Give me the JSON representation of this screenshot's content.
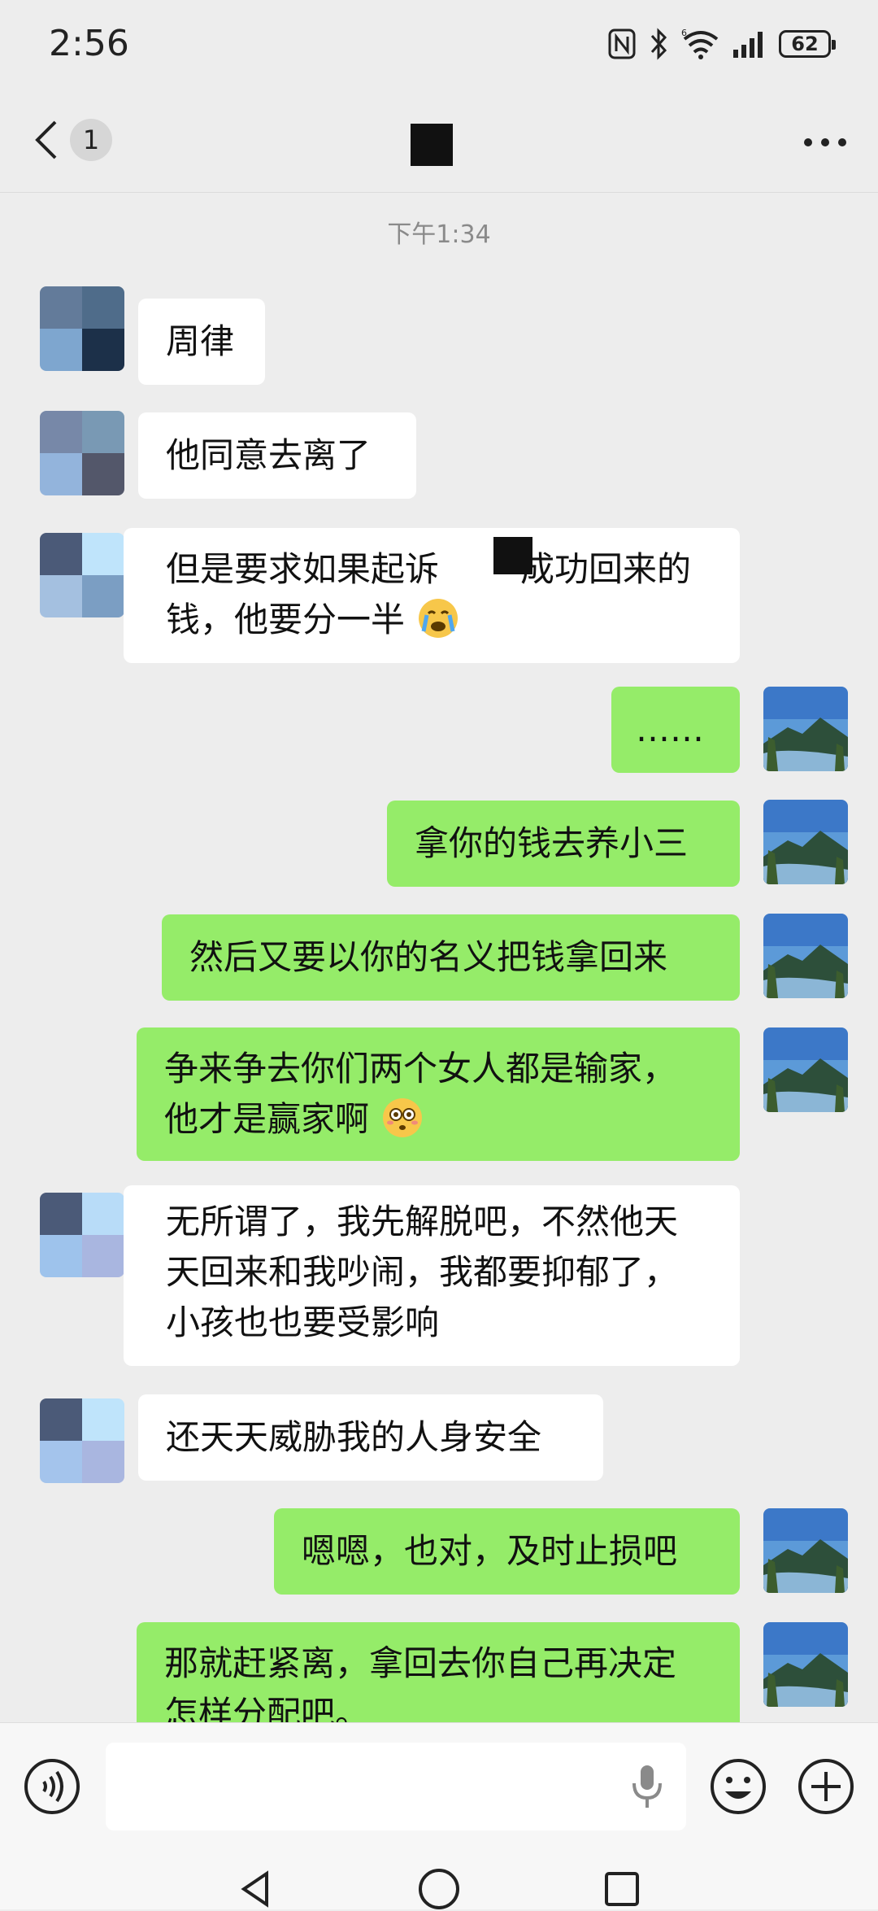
{
  "status_bar": {
    "time": "2:56",
    "battery": "62",
    "icons": [
      "nfc-icon",
      "bluetooth-icon",
      "wifi-6-icon",
      "signal-icon",
      "battery-icon"
    ]
  },
  "nav": {
    "unread_count": "1",
    "back_icon": "chevron-left-icon",
    "more_icon": "more-dots-icon"
  },
  "chat": {
    "timestamp": "下午1:34",
    "messages": [
      {
        "side": "in",
        "text": "周律"
      },
      {
        "side": "in",
        "text": "他同意去离了"
      },
      {
        "side": "in",
        "line1": "但是要求如果起诉",
        "line1b": "成功回来的",
        "line2": "钱，他要分一半",
        "emoji": "crying-emoji"
      },
      {
        "side": "out",
        "text": "……"
      },
      {
        "side": "out",
        "text": "拿你的钱去养小三"
      },
      {
        "side": "out",
        "text": "然后又要以你的名义把钱拿回来"
      },
      {
        "side": "out",
        "line1": "争来争去你们两个女人都是输家，",
        "line2": "他才是赢家啊",
        "emoji": "flushed-emoji"
      },
      {
        "side": "in",
        "line1": "无所谓了，我先解脱吧，不然他天",
        "line2": "天回来和我吵闹，我都要抑郁了，",
        "line3": "小孩也也要受影响"
      },
      {
        "side": "in",
        "text": "还天天威胁我的人身安全"
      },
      {
        "side": "out",
        "text": "嗯嗯，也对，及时止损吧"
      },
      {
        "side": "out",
        "line1": "那就赶紧离，拿回去你自己再决定",
        "line2": "怎样分配吧。"
      }
    ]
  },
  "input_bar": {
    "voice_icon": "voice-toggle-icon",
    "mic_icon": "microphone-icon",
    "emoji_icon": "emoji-icon",
    "plus_icon": "plus-icon"
  },
  "system_nav": {
    "icons": [
      "back-triangle-icon",
      "home-circle-icon",
      "recents-square-icon"
    ]
  },
  "colors": {
    "background": "#ededed",
    "incoming_bubble": "#ffffff",
    "outgoing_bubble": "#95ec69"
  }
}
